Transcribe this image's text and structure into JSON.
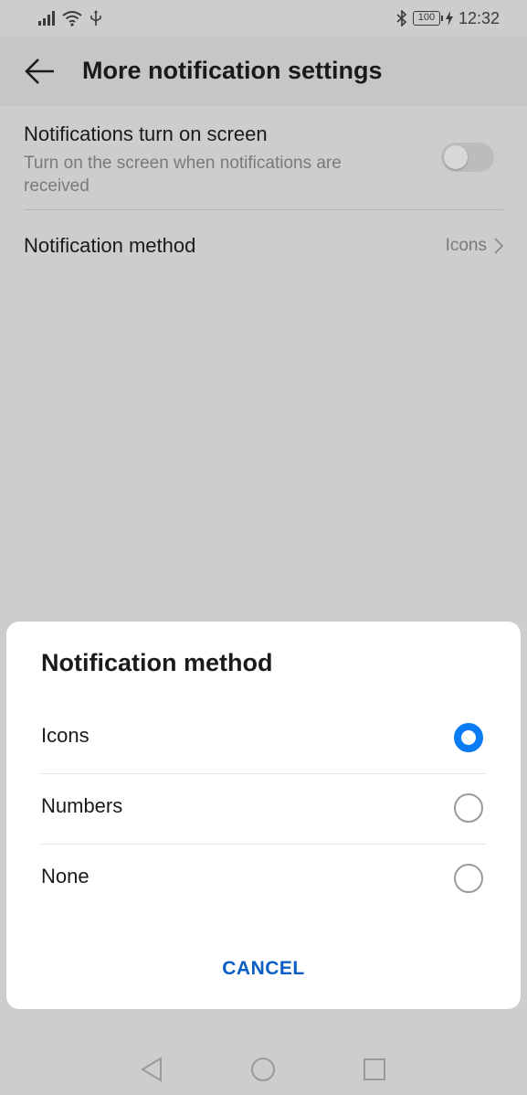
{
  "status_bar": {
    "time": "12:32",
    "battery": "100",
    "icons": [
      "signal-icon",
      "wifi-icon",
      "usb-icon",
      "bluetooth-icon",
      "battery-icon",
      "charging-icon"
    ]
  },
  "app_bar": {
    "title": "More notification settings",
    "back_icon": "back-arrow-icon"
  },
  "settings": {
    "screen_on": {
      "title": "Notifications turn on screen",
      "subtitle": "Turn on the screen when notifications are received",
      "enabled": false
    },
    "method": {
      "title": "Notification method",
      "value": "Icons",
      "chevron_icon": "chevron-right-icon"
    }
  },
  "dialog": {
    "title": "Notification method",
    "options": [
      {
        "label": "Icons",
        "selected": true
      },
      {
        "label": "Numbers",
        "selected": false
      },
      {
        "label": "None",
        "selected": false
      }
    ],
    "cancel_label": "CANCEL"
  },
  "nav_bar": {
    "icons": [
      "back-triangle-icon",
      "home-circle-icon",
      "recents-square-icon"
    ]
  },
  "colors": {
    "accent": "#0a7cf5",
    "cancel_text": "#0a5ec4",
    "scrim_background": "#cdcdcd"
  }
}
